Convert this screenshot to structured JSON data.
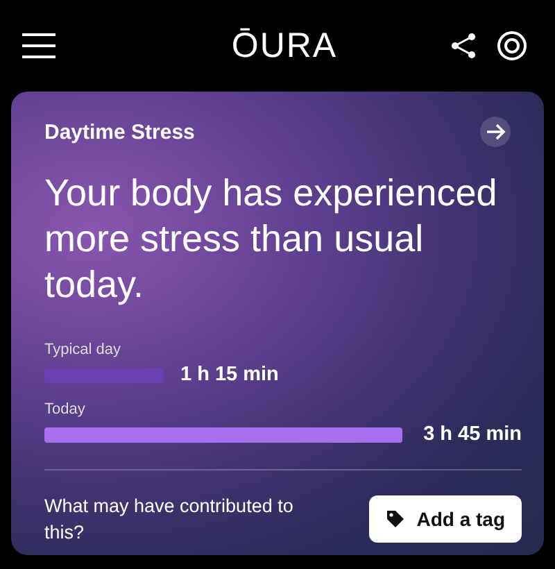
{
  "header": {
    "logo": "ŌURA"
  },
  "card": {
    "title": "Daytime Stress",
    "headline": "Your body has experienced more stress than usual today.",
    "bars": [
      {
        "label": "Typical day",
        "reading": "1 h 15 min",
        "kind": "short"
      },
      {
        "label": "Today",
        "reading": "3 h 45 min",
        "kind": "long"
      }
    ],
    "question": "What may have contributed to this?",
    "button": "Add a tag"
  }
}
